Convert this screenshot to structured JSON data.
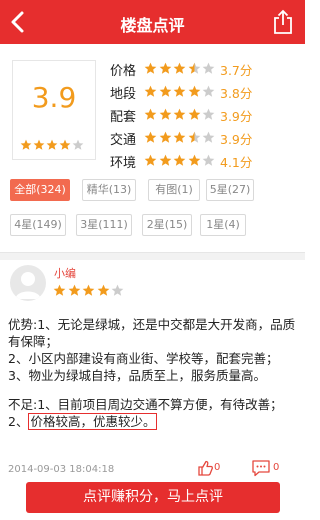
{
  "header": {
    "title": "楼盘点评",
    "back_icon": "back-arrow-icon",
    "share_icon": "share-icon"
  },
  "summary": {
    "overall_score": "3.9",
    "overall_stars": 4,
    "categories": [
      {
        "label": "价格",
        "score": "3.7分",
        "stars": 3.5
      },
      {
        "label": "地段",
        "score": "3.8分",
        "stars": 4
      },
      {
        "label": "配套",
        "score": "3.9分",
        "stars": 4
      },
      {
        "label": "交通",
        "score": "3.9分",
        "stars": 3.5
      },
      {
        "label": "环境",
        "score": "4.1分",
        "stars": 4
      }
    ]
  },
  "filters": [
    {
      "label": "全部(324)",
      "active": true
    },
    {
      "label": "精华(13)",
      "active": false
    },
    {
      "label": "有图(1)",
      "active": false
    },
    {
      "label": "5星(27)",
      "active": false
    },
    {
      "label": "4星(149)",
      "active": false
    },
    {
      "label": "3星(111)",
      "active": false
    },
    {
      "label": "2星(15)",
      "active": false
    },
    {
      "label": "1星(4)",
      "active": false
    }
  ],
  "review": {
    "username": "小编",
    "stars": 4,
    "advantages": "优势:1、无论是绿城，还是中交都是大开发商，品质有保障；\n2、小区内部建设有商业街、学校等，配套完善；\n3、物业为绿城自持，品质至上，服务质量高。",
    "disadvantages_intro": "不足:1、目前项目周边交通不算方便，有待改善；",
    "disadvantage_2_prefix": "2、",
    "disadvantage_2_text": "价格较高，优惠较少。",
    "date": "2014-09-03 18:04:18",
    "like_count": "0",
    "comment_count": "0"
  },
  "cta": {
    "label": "点评赚积分，马上点评"
  },
  "colors": {
    "brand_red": "#e62e2e",
    "star_orange": "#f29b1d",
    "star_empty": "#cccccc",
    "tag_active": "#f26a4f"
  }
}
